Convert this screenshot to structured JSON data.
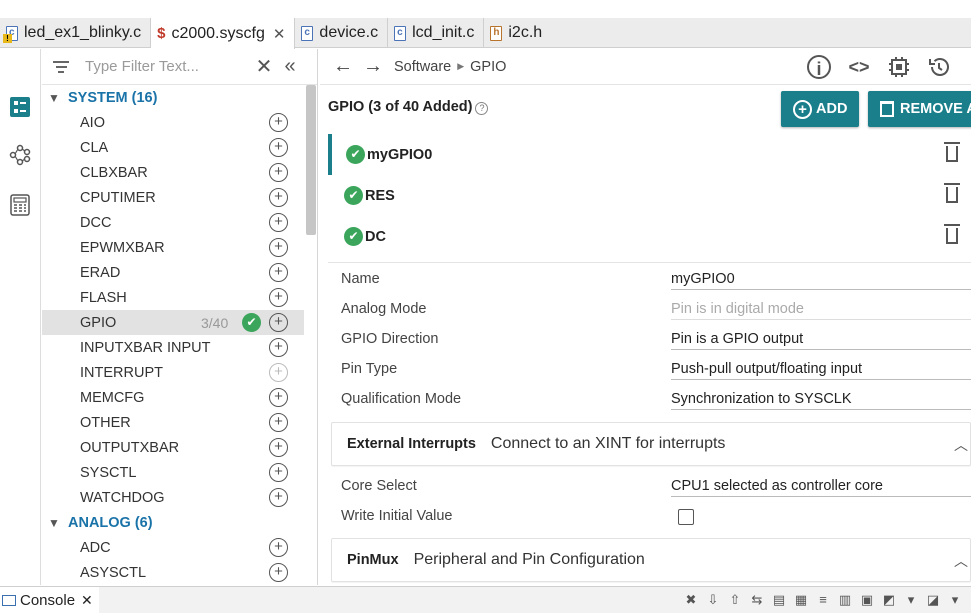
{
  "tabs": [
    {
      "label": "led_ex1_blinky.c",
      "icon": "c-file-warning-icon"
    },
    {
      "label": "c2000.syscfg",
      "icon": "syscfg-icon",
      "active": true
    },
    {
      "label": "device.c",
      "icon": "c-file-icon"
    },
    {
      "label": "lcd_init.c",
      "icon": "c-file-icon"
    },
    {
      "label": "i2c.h",
      "icon": "h-file-icon"
    }
  ],
  "filter": {
    "placeholder": "Type Filter Text..."
  },
  "tree": {
    "system_group": "SYSTEM (16)",
    "system_items": [
      "AIO",
      "CLA",
      "CLBXBAR",
      "CPUTIMER",
      "DCC",
      "EPWMXBAR",
      "ERAD",
      "FLASH",
      "GPIO",
      "INPUTXBAR INPUT",
      "INTERRUPT",
      "MEMCFG",
      "OTHER",
      "OUTPUTXBAR",
      "SYSCTL",
      "WATCHDOG"
    ],
    "gpio_count": "3/40",
    "analog_group": "ANALOG (6)",
    "analog_items": [
      "ADC",
      "ASYSCTL"
    ]
  },
  "breadcrumb": {
    "parent": "Software",
    "current": "GPIO"
  },
  "main": {
    "header": "GPIO (3 of 40 Added)",
    "add_label": "ADD",
    "remove_label": "REMOVE A",
    "instances": [
      "myGPIO0",
      "RES",
      "DC"
    ],
    "props": [
      {
        "label": "Name",
        "value": "myGPIO0"
      },
      {
        "label": "Analog Mode",
        "value": "Pin is in digital mode"
      },
      {
        "label": "GPIO Direction",
        "value": "Pin is a GPIO output"
      },
      {
        "label": "Pin Type",
        "value": "Push-pull output/floating input"
      },
      {
        "label": "Qualification Mode",
        "value": "Synchronization to SYSCLK"
      }
    ],
    "ext_int": {
      "title": "External Interrupts",
      "desc": "Connect to an XINT for interrupts"
    },
    "core_select": {
      "label": "Core Select",
      "value": "CPU1 selected as controller core"
    },
    "write_initial": {
      "label": "Write Initial Value"
    },
    "pinmux": {
      "title": "PinMux",
      "desc": "Peripheral and Pin Configuration"
    }
  },
  "console": {
    "label": "Console"
  },
  "colors": {
    "accent": "#1a7f8b",
    "ok_green": "#3ba55c",
    "group_blue": "#1a73a8"
  }
}
